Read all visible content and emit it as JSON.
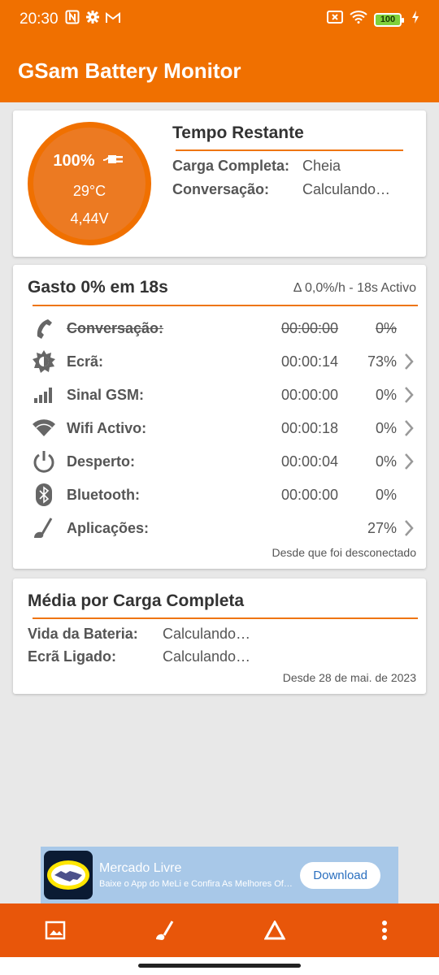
{
  "status": {
    "time": "20:30",
    "battery": "100"
  },
  "app": {
    "title": "GSam Battery Monitor"
  },
  "battery": {
    "percent": "100%",
    "temp": "29°C",
    "voltage": "4,44V"
  },
  "remaining": {
    "title": "Tempo Restante",
    "rows": [
      {
        "label": "Carga Completa:",
        "value": "Cheia"
      },
      {
        "label": "Conversação:",
        "value": "Calculando…"
      }
    ]
  },
  "usage": {
    "title": "Gasto 0% em 18s",
    "rate": "Δ 0,0%/h - 18s Activo",
    "rows": [
      {
        "icon": "phone-icon",
        "name": "Conversação:",
        "time": "00:00:00",
        "pct": "0%",
        "strike": true,
        "chevron": false
      },
      {
        "icon": "brightness-icon",
        "name": "Ecrã:",
        "time": "00:00:14",
        "pct": "73%",
        "strike": false,
        "chevron": true
      },
      {
        "icon": "signal-icon",
        "name": "Sinal GSM:",
        "time": "00:00:00",
        "pct": "0%",
        "strike": false,
        "chevron": true
      },
      {
        "icon": "wifi-icon",
        "name": "Wifi Activo:",
        "time": "00:00:18",
        "pct": "0%",
        "strike": false,
        "chevron": true
      },
      {
        "icon": "power-icon",
        "name": "Desperto:",
        "time": "00:00:04",
        "pct": "0%",
        "strike": false,
        "chevron": true
      },
      {
        "icon": "bluetooth-icon",
        "name": "Bluetooth:",
        "time": "00:00:00",
        "pct": "0%",
        "strike": false,
        "chevron": false
      },
      {
        "icon": "apps-icon",
        "name": "Aplicações:",
        "time": "",
        "pct": "27%",
        "strike": false,
        "chevron": true
      }
    ],
    "footer": "Desde que foi desconectado"
  },
  "average": {
    "title": "Média por Carga Completa",
    "rows": [
      {
        "label": "Vida da Bateria:",
        "value": "Calculando…"
      },
      {
        "label": "Ecrã Ligado:",
        "value": "Calculando…"
      }
    ],
    "footer": "Desde 28 de mai. de 2023"
  },
  "ad": {
    "brand": "Mercado Livre",
    "subtitle": "Baixe o App do MeLi e Confira As Melhores Ofertas",
    "button": "Download"
  },
  "colors": {
    "accent": "#f07000",
    "bottom_bar": "#e8560a"
  }
}
